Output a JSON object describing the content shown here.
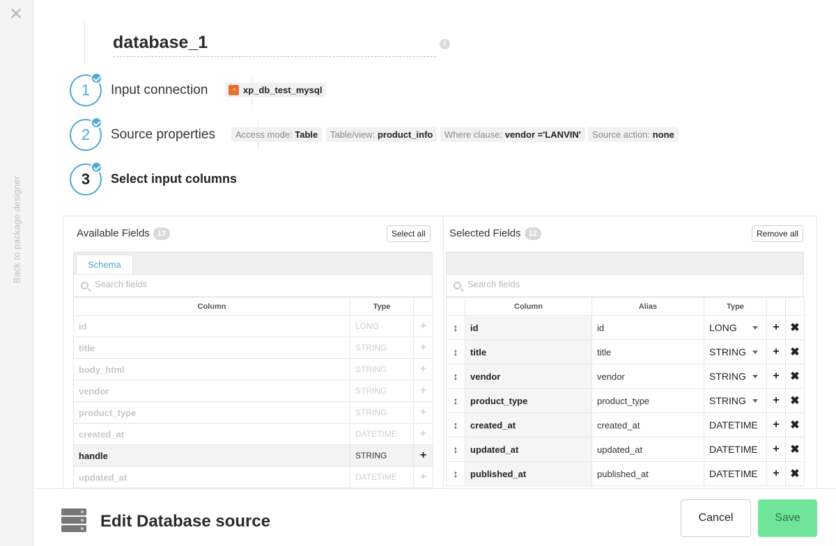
{
  "rail": {
    "back_label": "Back to package designer",
    "close_glyph": "✕"
  },
  "header": {
    "title": "database_1",
    "info_glyph": "!"
  },
  "steps": [
    {
      "number": "1",
      "label": "Input connection"
    },
    {
      "number": "2",
      "label": "Source properties"
    },
    {
      "number": "3",
      "label": "Select input columns"
    }
  ],
  "connection": {
    "name": "xp_db_test_mysql",
    "icon": "rss-feed-icon",
    "icon_color": "#e2722f"
  },
  "source_props": [
    {
      "key": "Access mode:",
      "value": "Table"
    },
    {
      "key": "Table/view:",
      "value": "product_info"
    },
    {
      "key": "Where clause:",
      "value": "vendor ='LANVIN'"
    },
    {
      "key": "Source action:",
      "value": "none"
    }
  ],
  "available": {
    "title": "Available Fields",
    "count": "13",
    "select_all_label": "Select all",
    "tab": "Schema",
    "search_placeholder": "Search fields",
    "headers": [
      "Column",
      "Type"
    ],
    "rows": [
      {
        "column": "id",
        "type": "LONG"
      },
      {
        "column": "title",
        "type": "STRING"
      },
      {
        "column": "body_html",
        "type": "STRING"
      },
      {
        "column": "vendor",
        "type": "STRING"
      },
      {
        "column": "product_type",
        "type": "STRING"
      },
      {
        "column": "created_at",
        "type": "DATETIME"
      },
      {
        "column": "handle",
        "type": "STRING"
      },
      {
        "column": "updated_at",
        "type": "DATETIME"
      }
    ]
  },
  "selected": {
    "title": "Selected Fields",
    "count": "12",
    "remove_all_label": "Remove all",
    "search_placeholder": "Search fields",
    "headers": [
      "Column",
      "Alias",
      "Type"
    ],
    "rows": [
      {
        "column": "id",
        "alias": "id",
        "type": "LONG"
      },
      {
        "column": "title",
        "alias": "title",
        "type": "STRING"
      },
      {
        "column": "vendor",
        "alias": "vendor",
        "type": "STRING"
      },
      {
        "column": "product_type",
        "alias": "product_type",
        "type": "STRING"
      },
      {
        "column": "created_at",
        "alias": "created_at",
        "type": "DATETIME"
      },
      {
        "column": "updated_at",
        "alias": "updated_at",
        "type": "DATETIME"
      },
      {
        "column": "published_at",
        "alias": "published_at",
        "type": "DATETIME"
      }
    ]
  },
  "footer": {
    "title": "Edit Database source",
    "cancel_label": "Cancel",
    "save_label": "Save"
  },
  "colors": {
    "accent": "#4ea9d6",
    "save": "#6fe59a"
  }
}
